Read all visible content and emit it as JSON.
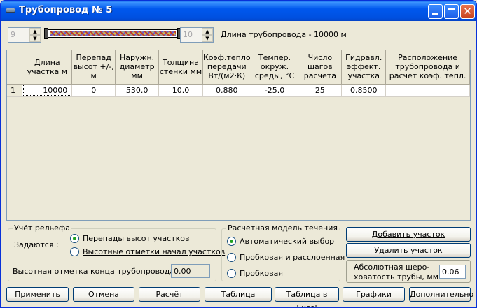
{
  "window": {
    "title": "Трубопровод № 5"
  },
  "pipe": {
    "spin_left": "9",
    "spin_right": "10",
    "length_label": "Длина трубопровода - 10000 м"
  },
  "grid": {
    "headers": [
      "",
      "Длина участка м",
      "Перепад высот +/-, м",
      "Наружн. диаметр мм",
      "Толщина стенки мм",
      "Коэф.тепло передачи Вт/(м2·К)",
      "Темпер. окруж. среды, °С",
      "Число шагов расчёта",
      "Гидравл. эффект. участка",
      "Расположение трубопровода и расчет коэф. тепл."
    ],
    "rows": [
      [
        "1",
        "10000",
        "0",
        "530.0",
        "10.0",
        "0.880",
        "-25.0",
        "25",
        "0.8500",
        ""
      ]
    ]
  },
  "relief": {
    "legend": "Учёт рельефа",
    "set_label": "Задаются :",
    "option1": "Перепады высот участков",
    "option2": "Высотные отметки начал участков",
    "selected": "Перепады высот участков",
    "end_height_label": "Высотная отметка конца трубопровода, м :",
    "end_height_value": "0.00"
  },
  "flow_model": {
    "legend": "Расчетная модель течения",
    "option1": "Автоматический выбор",
    "option2": "Пробковая и расслоенная",
    "option3": "Пробковая",
    "selected": "Автоматический выбор"
  },
  "side": {
    "add_label": "Добавить участок",
    "delete_label": "Удалить участок",
    "roughness_label_1": "Абсолютная шеро-",
    "roughness_label_2": "ховатость трубы, мм :",
    "roughness_value": "0.06"
  },
  "buttons": {
    "apply": "Применить",
    "cancel": "Отмена",
    "calc": "Расчёт",
    "table": "Таблица",
    "excel": "Таблица в Excel",
    "graphs": "Графики",
    "extra": "Дополнительно"
  },
  "colors": {
    "titlebar": "#0054E3",
    "face": "#ECE9D8",
    "radio_dot": "#21A121"
  }
}
